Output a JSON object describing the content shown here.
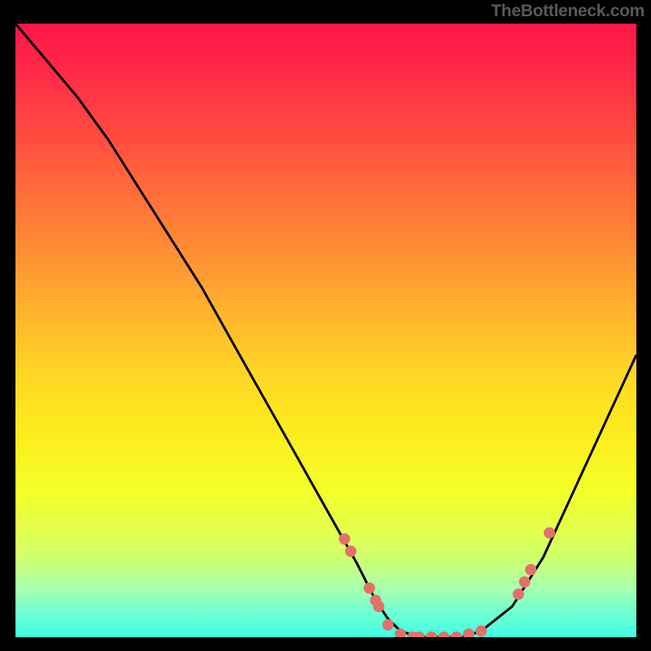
{
  "watermark": "TheBottleneck.com",
  "chart_data": {
    "type": "line",
    "title": "",
    "xlabel": "",
    "ylabel": "",
    "xlim": [
      0,
      100
    ],
    "ylim": [
      0,
      100
    ],
    "grid": false,
    "legend": false,
    "series": [
      {
        "name": "curve",
        "x": [
          0,
          5,
          10,
          15,
          20,
          25,
          30,
          35,
          40,
          45,
          50,
          55,
          58,
          60,
          62,
          65,
          68,
          72,
          75,
          80,
          85,
          90,
          95,
          100
        ],
        "y": [
          100,
          94,
          88,
          81,
          73,
          65,
          57,
          48,
          39,
          30,
          21,
          12,
          6,
          3,
          1,
          0,
          0,
          0,
          1,
          5,
          13,
          24,
          35,
          46
        ]
      }
    ],
    "markers": [
      {
        "x": 53,
        "y": 16
      },
      {
        "x": 54,
        "y": 14
      },
      {
        "x": 57,
        "y": 8
      },
      {
        "x": 58,
        "y": 6
      },
      {
        "x": 58.5,
        "y": 5
      },
      {
        "x": 60,
        "y": 2
      },
      {
        "x": 62,
        "y": 0.5
      },
      {
        "x": 64,
        "y": 0
      },
      {
        "x": 65,
        "y": 0
      },
      {
        "x": 67,
        "y": 0
      },
      {
        "x": 69,
        "y": 0
      },
      {
        "x": 71,
        "y": 0
      },
      {
        "x": 73,
        "y": 0.5
      },
      {
        "x": 75,
        "y": 1
      },
      {
        "x": 81,
        "y": 7
      },
      {
        "x": 82,
        "y": 9
      },
      {
        "x": 83,
        "y": 11
      },
      {
        "x": 86,
        "y": 17
      }
    ],
    "marker_color": "#e2706b",
    "marker_radius_px": 7
  },
  "colors": {
    "curve_stroke": "#000000",
    "border": "#000000"
  }
}
